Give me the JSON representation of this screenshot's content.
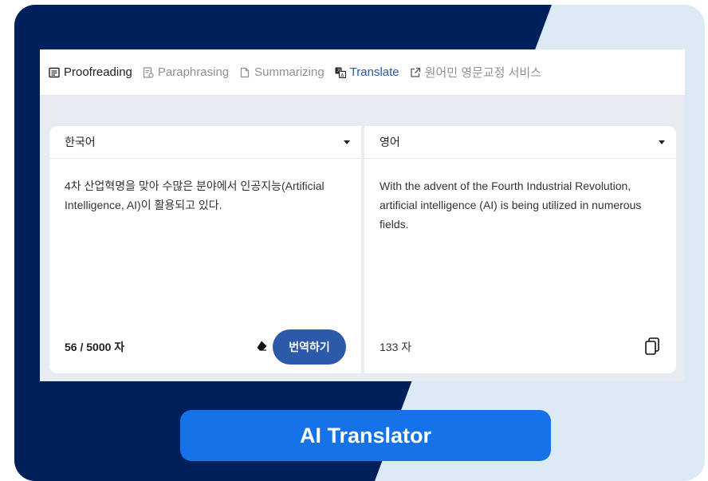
{
  "nav": {
    "items": [
      {
        "label": "Proofreading",
        "icon": "proofreading-icon"
      },
      {
        "label": "Paraphrasing",
        "icon": "paraphrasing-icon"
      },
      {
        "label": "Summarizing",
        "icon": "summarizing-icon"
      },
      {
        "label": "Translate",
        "icon": "translate-icon"
      },
      {
        "label": "원어민 영문교정 서비스",
        "icon": "external-link-icon"
      }
    ]
  },
  "source": {
    "language": "한국어",
    "text": "4차 산업혁명을 맞아 수많은 분야에서 인공지능(Artificial Intelligence, AI)이 활용되고 있다.",
    "count": "56 / 5000 자",
    "translate_label": "번역하기"
  },
  "target": {
    "language": "영어",
    "text": "With the advent of the Fourth Industrial Revolution, artificial intelligence (AI) is being utilized in numerous fields.",
    "count": "133 자"
  },
  "cta_label": "AI Translator",
  "colors": {
    "navy": "#00205c",
    "light": "#dcebf3",
    "accent": "#2c5aa8",
    "cta": "#1572e8"
  }
}
